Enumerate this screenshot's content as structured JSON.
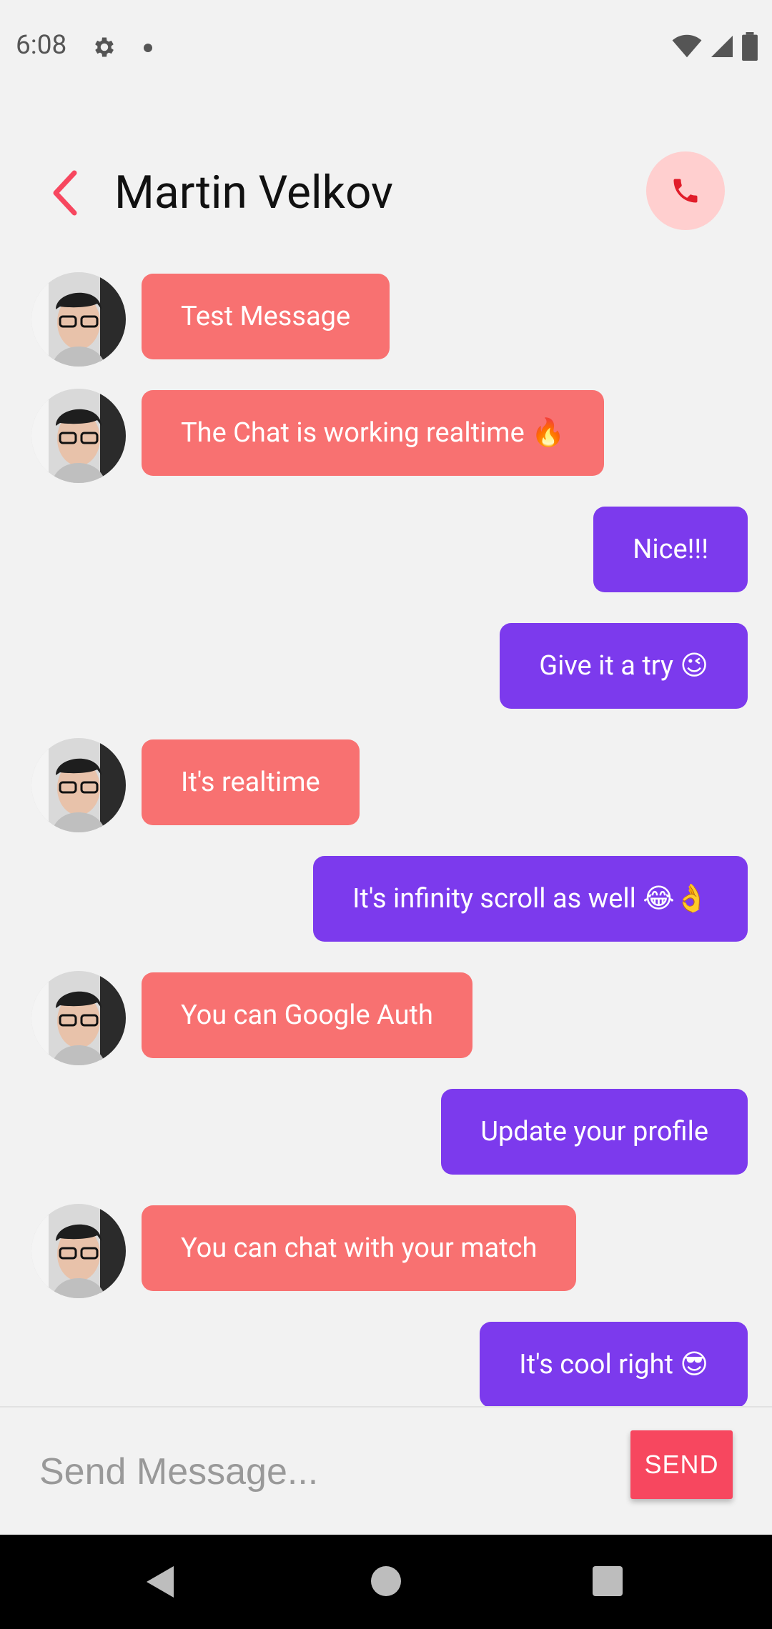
{
  "status": {
    "time": "6:08"
  },
  "header": {
    "title": "Martin Velkov"
  },
  "messages": [
    {
      "side": "in",
      "text": "Test Message"
    },
    {
      "side": "in",
      "text": "The Chat is working realtime 🔥"
    },
    {
      "side": "out",
      "text": "Nice!!!"
    },
    {
      "side": "out",
      "text": "Give it a try 😉"
    },
    {
      "side": "in",
      "text": "It's realtime"
    },
    {
      "side": "out",
      "text": "It's infinity scroll as well 😂👌"
    },
    {
      "side": "in",
      "text": "You can Google Auth"
    },
    {
      "side": "out",
      "text": "Update your profile"
    },
    {
      "side": "in",
      "text": "You can chat with your match"
    },
    {
      "side": "out",
      "text": "It's cool right 😎"
    }
  ],
  "input": {
    "placeholder": "Send Message...",
    "value": ""
  },
  "send_label": "SEND",
  "colors": {
    "incoming": "#f87171",
    "outgoing": "#7c3aed",
    "accent": "#f7475f",
    "call_bg": "#ffcfcf"
  },
  "icons": [
    "gear-icon",
    "wifi-icon",
    "signal-icon",
    "battery-icon",
    "back-arrow-icon",
    "phone-icon",
    "nav-back-icon",
    "nav-home-icon",
    "nav-recents-icon"
  ]
}
